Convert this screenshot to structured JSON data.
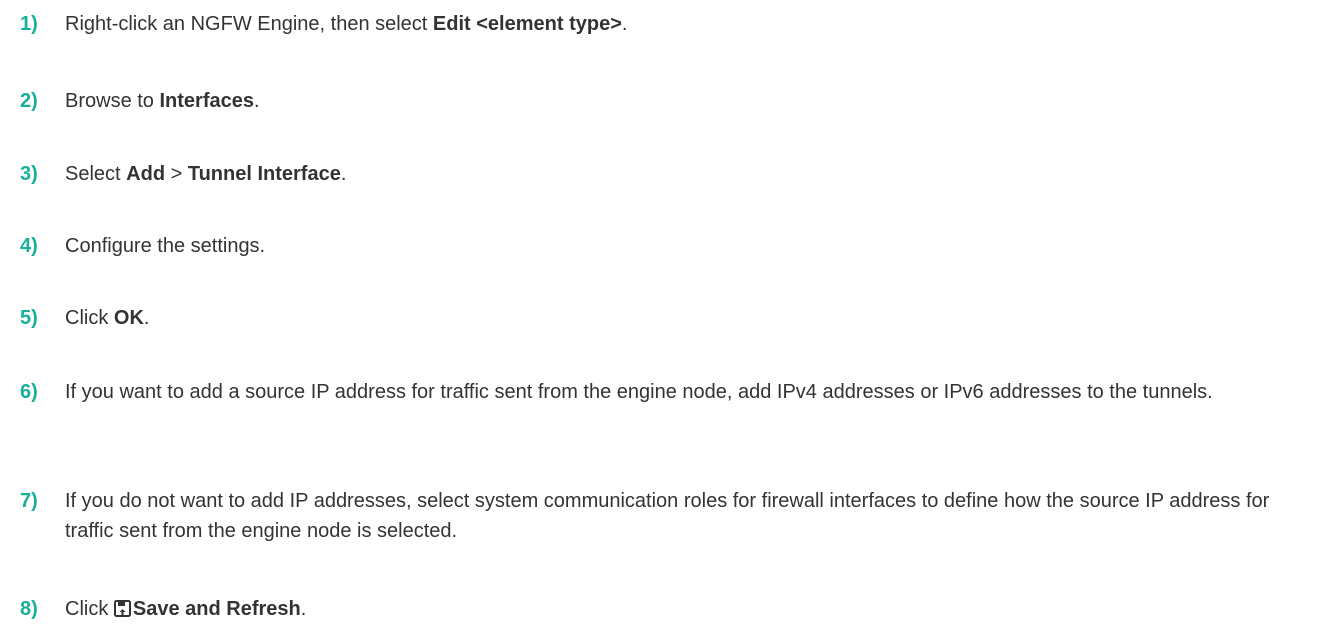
{
  "steps": [
    {
      "num": "1)",
      "pre": "Right-click an NGFW Engine, then select ",
      "bold": "Edit <element type>",
      "post": "."
    },
    {
      "num": "2)",
      "pre": "Browse to ",
      "bold": "Interfaces",
      "post": "."
    },
    {
      "num": "3)",
      "pre": "Select ",
      "bold": "Add",
      "mid": " > ",
      "bold2": "Tunnel Interface",
      "post": "."
    },
    {
      "num": "4)",
      "text": "Configure the settings."
    },
    {
      "num": "5)",
      "pre": "Click ",
      "bold": "OK",
      "post": "."
    },
    {
      "num": "6)",
      "text": "If you want to add a source IP address for traffic sent from the engine node, add IPv4 addresses or IPv6 addresses to the tunnels."
    },
    {
      "num": "7)",
      "text": "If you do not want to add IP addresses, select system communication roles for firewall interfaces to define how the source IP address for traffic sent from the engine node is selected."
    },
    {
      "num": "8)",
      "pre": "Click ",
      "icon": "save-and-refresh-icon",
      "bold": "Save and Refresh",
      "post": "."
    }
  ],
  "colors": {
    "step_number": "#1aaf9a",
    "text": "#333333"
  }
}
